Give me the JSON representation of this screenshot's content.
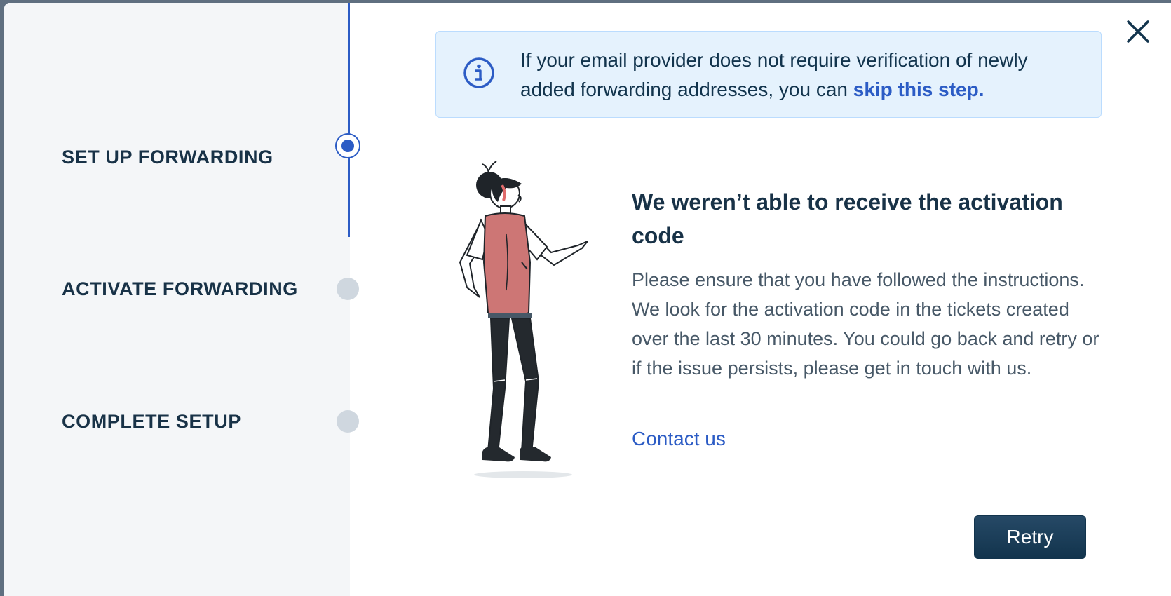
{
  "wizard": {
    "steps": [
      {
        "label": "SET UP FORWARDING",
        "active": true
      },
      {
        "label": "ACTIVATE FORWARDING",
        "active": false
      },
      {
        "label": "COMPLETE SETUP",
        "active": false
      }
    ]
  },
  "info_banner": {
    "icon": "info-icon",
    "text": "If your email provider does not require verification of newly added forwarding addresses, you can ",
    "link": "skip this step."
  },
  "main": {
    "heading": "We weren’t able to receive the activation code",
    "body": "Please ensure that you have followed the instructions. We look for the activation code in the tickets created over the last 30 minutes. You could go back and retry or if the issue persists, please get in touch with us.",
    "contact_link": "Contact us",
    "retry_label": "Retry"
  },
  "colors": {
    "accent": "#2c5cc5",
    "primary_button": "#12344d",
    "sidebar_bg": "#f4f6f8",
    "info_bg": "#e5f2fd"
  }
}
